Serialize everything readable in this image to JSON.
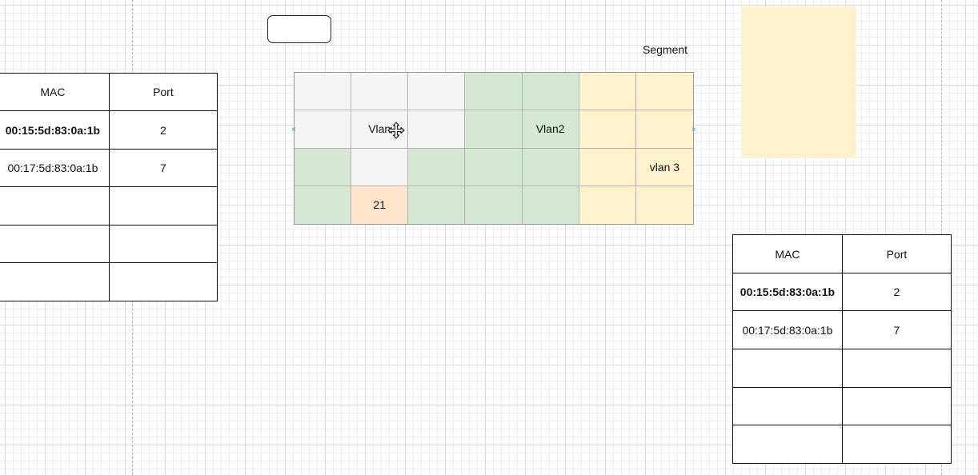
{
  "segment_label": "Segment",
  "colors": {
    "vlan1": "#f5f5f5",
    "vlan2": "#d5e8d4",
    "vlan3": "#fff2cc",
    "port": "#ffe6cc",
    "sticky": "#fff2cc"
  },
  "icons": {
    "move": "move-icon",
    "handle": "resize-handle"
  },
  "left_table": {
    "headers": [
      "MAC",
      "Port"
    ],
    "rows": [
      {
        "mac": "00:15:5d:83:0a:1b",
        "port": "2",
        "bold": true
      },
      {
        "mac": "00:17:5d:83:0a:1b",
        "port": "7",
        "bold": false
      },
      {
        "mac": "",
        "port": "",
        "bold": false
      },
      {
        "mac": "",
        "port": "",
        "bold": false
      },
      {
        "mac": "",
        "port": "",
        "bold": false
      }
    ]
  },
  "right_table": {
    "headers": [
      "MAC",
      "Port"
    ],
    "rows": [
      {
        "mac": "00:15:5d:83:0a:1b",
        "port": "2",
        "bold": true
      },
      {
        "mac": "00:17:5d:83:0a:1b",
        "port": "7",
        "bold": false
      },
      {
        "mac": "",
        "port": "",
        "bold": false
      },
      {
        "mac": "",
        "port": "",
        "bold": false
      },
      {
        "mac": "",
        "port": "",
        "bold": false
      }
    ]
  },
  "switch_grid": {
    "rows": [
      [
        {
          "vlan": "vlan1",
          "text": ""
        },
        {
          "vlan": "vlan1",
          "text": ""
        },
        {
          "vlan": "vlan1",
          "text": ""
        },
        {
          "vlan": "vlan2",
          "text": ""
        },
        {
          "vlan": "vlan2",
          "text": ""
        },
        {
          "vlan": "vlan3",
          "text": ""
        },
        {
          "vlan": "vlan3",
          "text": ""
        }
      ],
      [
        {
          "vlan": "vlan1",
          "text": ""
        },
        {
          "vlan": "vlan1",
          "text": "Vlan"
        },
        {
          "vlan": "vlan1",
          "text": ""
        },
        {
          "vlan": "vlan2",
          "text": ""
        },
        {
          "vlan": "vlan2",
          "text": "Vlan2"
        },
        {
          "vlan": "vlan3",
          "text": ""
        },
        {
          "vlan": "vlan3",
          "text": ""
        }
      ],
      [
        {
          "vlan": "vlan2",
          "text": ""
        },
        {
          "vlan": "vlan1",
          "text": ""
        },
        {
          "vlan": "vlan2",
          "text": ""
        },
        {
          "vlan": "vlan2",
          "text": ""
        },
        {
          "vlan": "vlan2",
          "text": ""
        },
        {
          "vlan": "vlan3",
          "text": ""
        },
        {
          "vlan": "vlan3",
          "text": "vlan 3"
        }
      ],
      [
        {
          "vlan": "vlan2",
          "text": ""
        },
        {
          "vlan": "port",
          "text": "21"
        },
        {
          "vlan": "vlan2",
          "text": ""
        },
        {
          "vlan": "vlan2",
          "text": ""
        },
        {
          "vlan": "vlan2",
          "text": ""
        },
        {
          "vlan": "vlan3",
          "text": ""
        },
        {
          "vlan": "vlan3",
          "text": ""
        }
      ]
    ]
  }
}
